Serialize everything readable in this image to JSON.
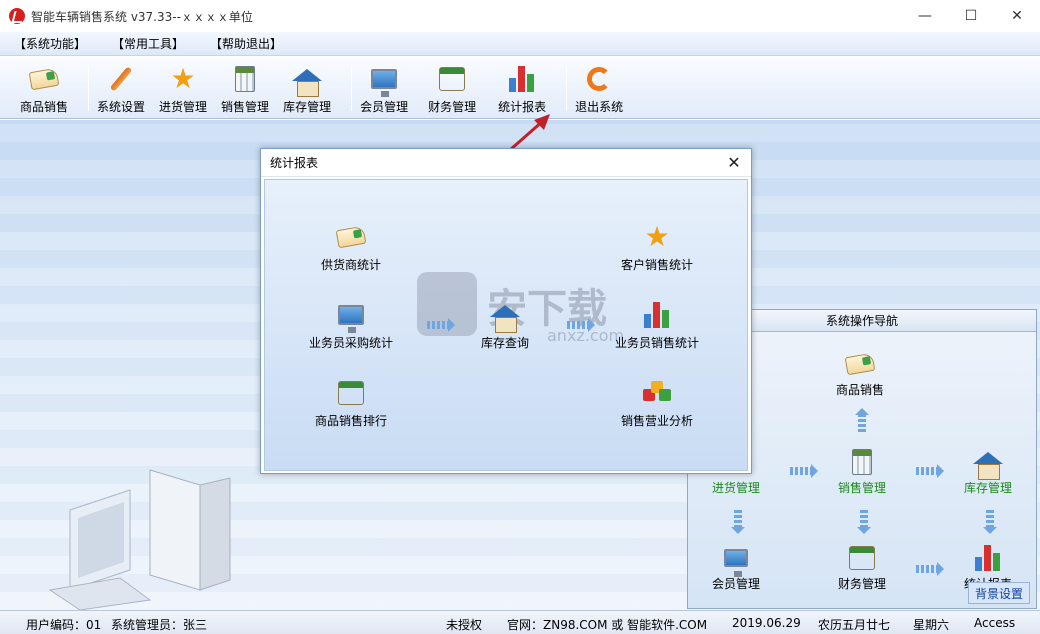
{
  "window": {
    "title": "智能车辆销售系统 v37.33--ｘｘｘｘ单位"
  },
  "menu": [
    "【系统功能】",
    "【常用工具】",
    "【帮助退出】"
  ],
  "toolbar": [
    {
      "label": "商品销售",
      "icon": "hand-card-icon"
    },
    {
      "label": "系统设置",
      "icon": "wrench-icon"
    },
    {
      "label": "进货管理",
      "icon": "star-icon"
    },
    {
      "label": "销售管理",
      "icon": "calculator-icon"
    },
    {
      "label": "库存管理",
      "icon": "house-icon"
    },
    {
      "label": "会员管理",
      "icon": "monitor-icon"
    },
    {
      "label": "财务管理",
      "icon": "cash-register-icon"
    },
    {
      "label": "统计报表",
      "icon": "bar-chart-icon"
    },
    {
      "label": "退出系统",
      "icon": "exit-icon"
    }
  ],
  "dialog": {
    "title": "统计报表",
    "items": [
      {
        "label": "供货商统计"
      },
      {
        "label": "客户销售统计"
      },
      {
        "label": "业务员采购统计"
      },
      {
        "label": "库存查询"
      },
      {
        "label": "业务员销售统计"
      },
      {
        "label": "商品销售排行"
      },
      {
        "label": "销售营业分析"
      }
    ]
  },
  "watermark": {
    "text": "安下载",
    "sub": "anxz.com"
  },
  "nav": {
    "title": "系统操作导航",
    "partial_label": "置",
    "items": {
      "sales_product": "商品销售",
      "purchase": "进货管理",
      "sales": "销售管理",
      "inventory": "库存管理",
      "member": "会员管理",
      "finance": "财务管理",
      "report": "统计报表"
    },
    "bg_button": "背景设置"
  },
  "status": {
    "user_code": "用户编码：01",
    "admin": "系统管理员：张三",
    "license": "未授权",
    "website": "官网：ZN98.COM 或 智能软件.COM",
    "date": "2019.06.29",
    "lunar": "农历五月廿七",
    "weekday": "星期六",
    "db": "Access"
  },
  "colors": {
    "accent": "#2e6fb8",
    "nav_green": "#1a8a1a",
    "arrow": "#c0202a"
  }
}
